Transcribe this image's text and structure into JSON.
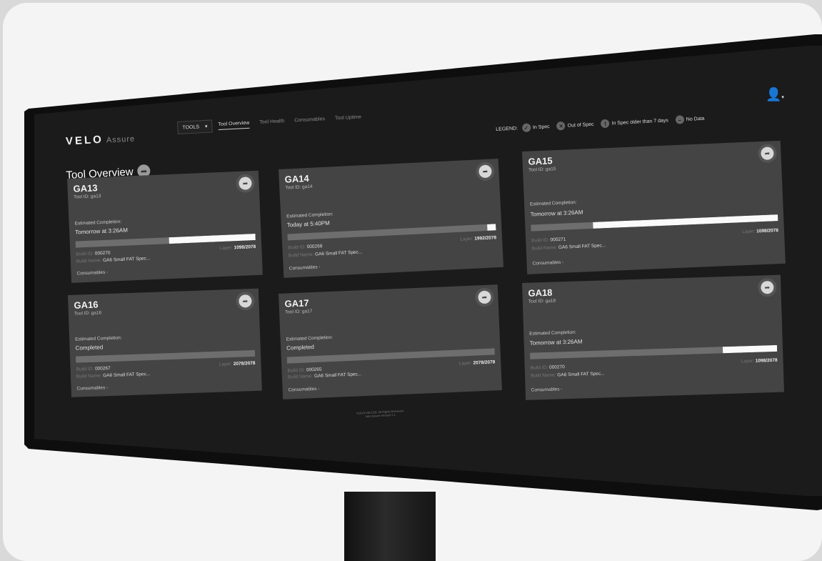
{
  "app": {
    "brand": "VELO",
    "product": "Assure"
  },
  "nav": {
    "tools_label": "TOOLS",
    "tools_caret": "▾",
    "links": [
      "Tool Overview",
      "Tool Health",
      "Consumables",
      "Tool Uptime"
    ]
  },
  "legend": {
    "label": "LEGEND:",
    "items": [
      {
        "icon": "check-icon",
        "glyph": "✓",
        "label": "In Spec"
      },
      {
        "icon": "x-icon",
        "glyph": "✕",
        "label": "Out of Spec"
      },
      {
        "icon": "clock-icon",
        "glyph": "!",
        "label": "In Spec older than 7 days"
      },
      {
        "icon": "dash-icon",
        "glyph": "–",
        "label": "No Data"
      }
    ]
  },
  "user": {
    "icon": "user-icon",
    "glyph": "👤",
    "caret": "▾"
  },
  "page": {
    "title": "Tool Overview",
    "title_button_glyph": "➦"
  },
  "card_labels": {
    "est": "Estimated Completion:",
    "build_id": "Build ID:",
    "build_name": "Build Name:",
    "layer": "Layer:",
    "consumables": "Consumables -",
    "share_glyph": "➦"
  },
  "cards": [
    {
      "name": "GA13",
      "tool_id": "Tool ID: ga13",
      "completion": "Tomorrow at 3:26AM",
      "progress": 0.52,
      "build_id": "000270",
      "build_name": "GA6 Small FAT Spec...",
      "layer": "1098/2078"
    },
    {
      "name": "GA14",
      "tool_id": "Tool ID: ga14",
      "completion": "Today at 5:40PM",
      "progress": 0.96,
      "build_id": "000268",
      "build_name": "GA6 Small FAT Spec...",
      "layer": "1992/2078"
    },
    {
      "name": "GA15",
      "tool_id": "Tool ID: ga15",
      "completion": "Tomorrow at 3:26AM",
      "progress": 0.25,
      "build_id": "000271",
      "build_name": "GA6 Small FAT Spec...",
      "layer": "1098/2078"
    },
    {
      "name": "GA16",
      "tool_id": "Tool ID: ga16",
      "completion": "Completed",
      "progress": 1.0,
      "build_id": "000267",
      "build_name": "GA6 Small FAT Spec...",
      "layer": "2078/2078"
    },
    {
      "name": "GA17",
      "tool_id": "Tool ID: ga17",
      "completion": "Completed",
      "progress": 1.0,
      "build_id": "000265",
      "build_name": "GA6 Small FAT Spec...",
      "layer": "2078/2078"
    },
    {
      "name": "GA18",
      "tool_id": "Tool ID: ga18",
      "completion": "Tomorrow at 3:26AM",
      "progress": 0.78,
      "build_id": "000270",
      "build_name": "GA6 Small FAT Spec...",
      "layer": "1098/2078"
    }
  ],
  "footer": {
    "line1": "©2018 VELO3D. All Rights Reserved.",
    "line2": "Velo Assure Version 2.1"
  }
}
